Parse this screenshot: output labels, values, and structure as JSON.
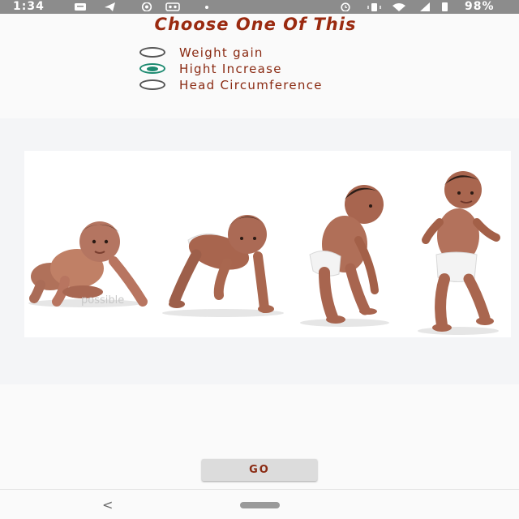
{
  "status_bar": {
    "time": "1:34",
    "battery": "98%",
    "icons_left": [
      "message-icon",
      "telegram-icon",
      "whatsapp-icon",
      "voicemail-icon",
      "dot-icon"
    ],
    "icons_right": [
      "alarm-icon",
      "vibrate-icon",
      "wifi-icon",
      "signal-icon",
      "battery-icon"
    ]
  },
  "header": {
    "title": "Choose One Of This"
  },
  "options": [
    {
      "label": "Weight gain",
      "checked": false
    },
    {
      "label": "Hight Increase",
      "checked": true
    },
    {
      "label": "Head Circumference",
      "checked": false
    }
  ],
  "image": {
    "watermark": "possible"
  },
  "go_button": {
    "label": "GO"
  },
  "nav": {
    "back_glyph": "<"
  },
  "colors": {
    "accent_text": "#9a2a10",
    "radio_checked": "#1d8a70",
    "status_bar": "#8c8c8c"
  }
}
